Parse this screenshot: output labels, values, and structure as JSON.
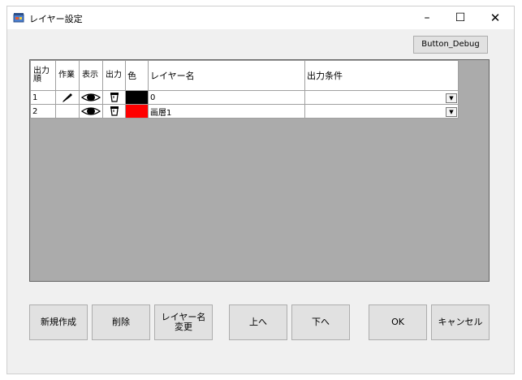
{
  "window": {
    "title": "レイヤー設定",
    "minimize": "–",
    "maximize": "☐",
    "close": "✕"
  },
  "toolbar": {
    "debug_label": "Button_Debug"
  },
  "grid": {
    "headers": {
      "order": "出力順",
      "work": "作業",
      "display": "表示",
      "output": "出力",
      "color": "色",
      "layer_name": "レイヤー名",
      "output_condition": "出力条件"
    },
    "rows": [
      {
        "order": "1",
        "work_icon": "pencil-icon",
        "display_icon": "eye-icon",
        "output_icon": "output-icon",
        "color": "#000000",
        "layer_name": "0",
        "output_condition": ""
      },
      {
        "order": "2",
        "work_icon": "",
        "display_icon": "eye-icon",
        "output_icon": "output-icon",
        "color": "#ff0000",
        "layer_name": "画層1",
        "output_condition": ""
      }
    ]
  },
  "buttons": {
    "new": "新規作成",
    "delete": "削除",
    "rename": "レイヤー名\n変更",
    "up": "上へ",
    "down": "下へ",
    "ok": "OK",
    "cancel": "キャンセル"
  }
}
